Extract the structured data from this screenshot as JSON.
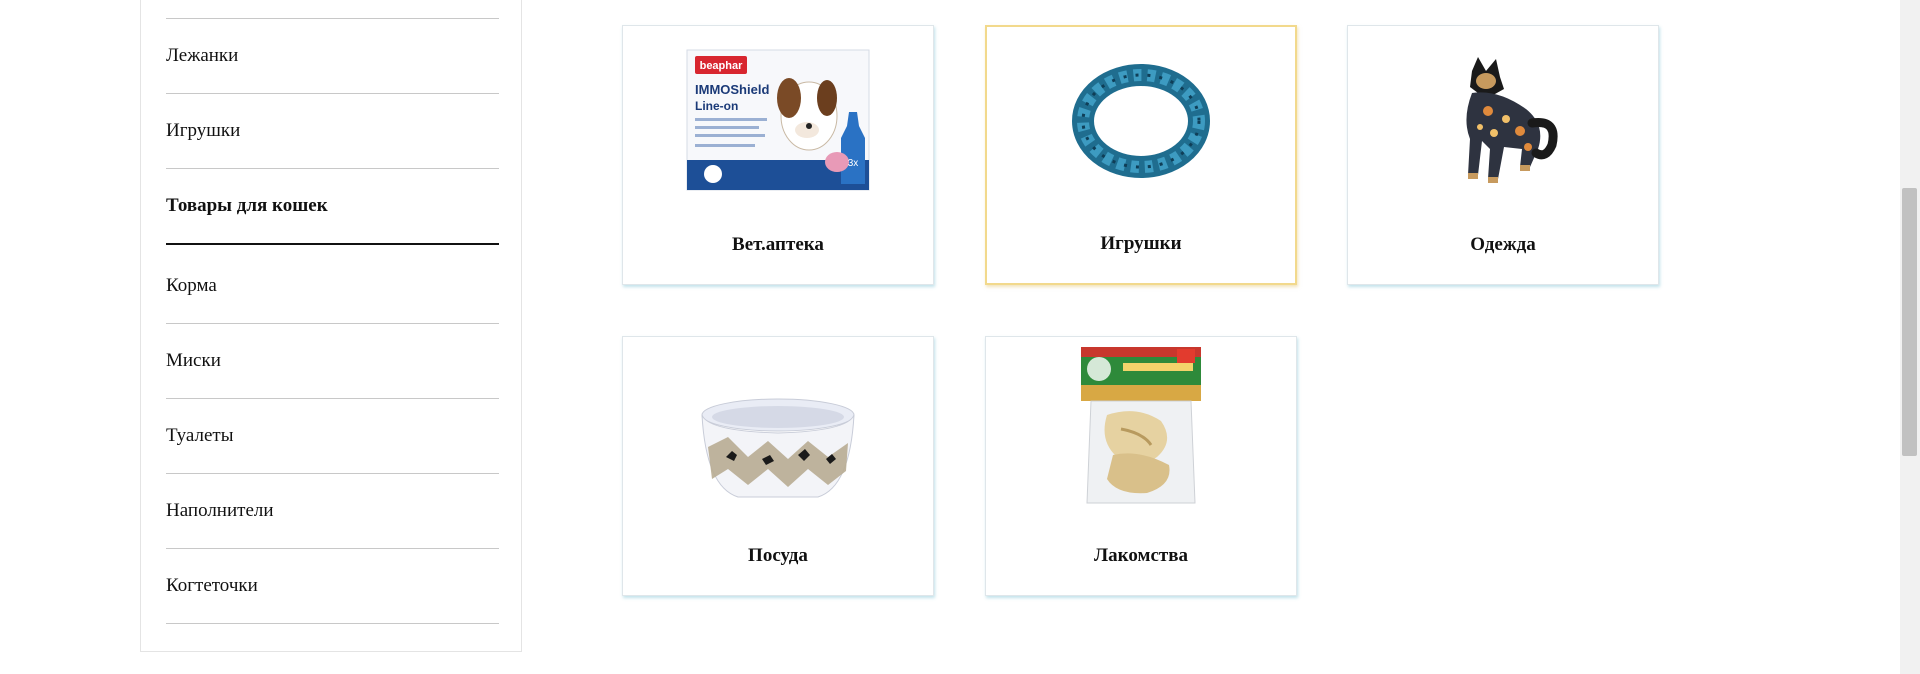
{
  "sidebar": {
    "items": [
      {
        "label": "Лежанки",
        "active": false
      },
      {
        "label": "Игрушки",
        "active": false
      },
      {
        "label": "Товары для кошек",
        "active": true
      },
      {
        "label": "Корма",
        "active": false
      },
      {
        "label": "Миски",
        "active": false
      },
      {
        "label": "Туалеты",
        "active": false
      },
      {
        "label": "Наполнители",
        "active": false
      },
      {
        "label": "Когтеточки",
        "active": false
      }
    ]
  },
  "categories": [
    {
      "label": "Вет.аптека",
      "icon": "vet-pharmacy-product-icon",
      "selected": false,
      "package": {
        "brand": "beaphar",
        "line1": "IMMOShield",
        "line2": "Line-on",
        "dose": "3x"
      }
    },
    {
      "label": "Игрушки",
      "icon": "rope-ring-toy-icon",
      "selected": true
    },
    {
      "label": "Одежда",
      "icon": "dog-clothing-icon",
      "selected": false
    },
    {
      "label": "Посуда",
      "icon": "dog-bowl-icon",
      "selected": false
    },
    {
      "label": "Лакомства",
      "icon": "treats-bag-icon",
      "selected": false
    }
  ],
  "colors": {
    "selected_border": "#f2d98c",
    "card_shadow": "#78bed2",
    "divider": "#c8c8c8"
  }
}
